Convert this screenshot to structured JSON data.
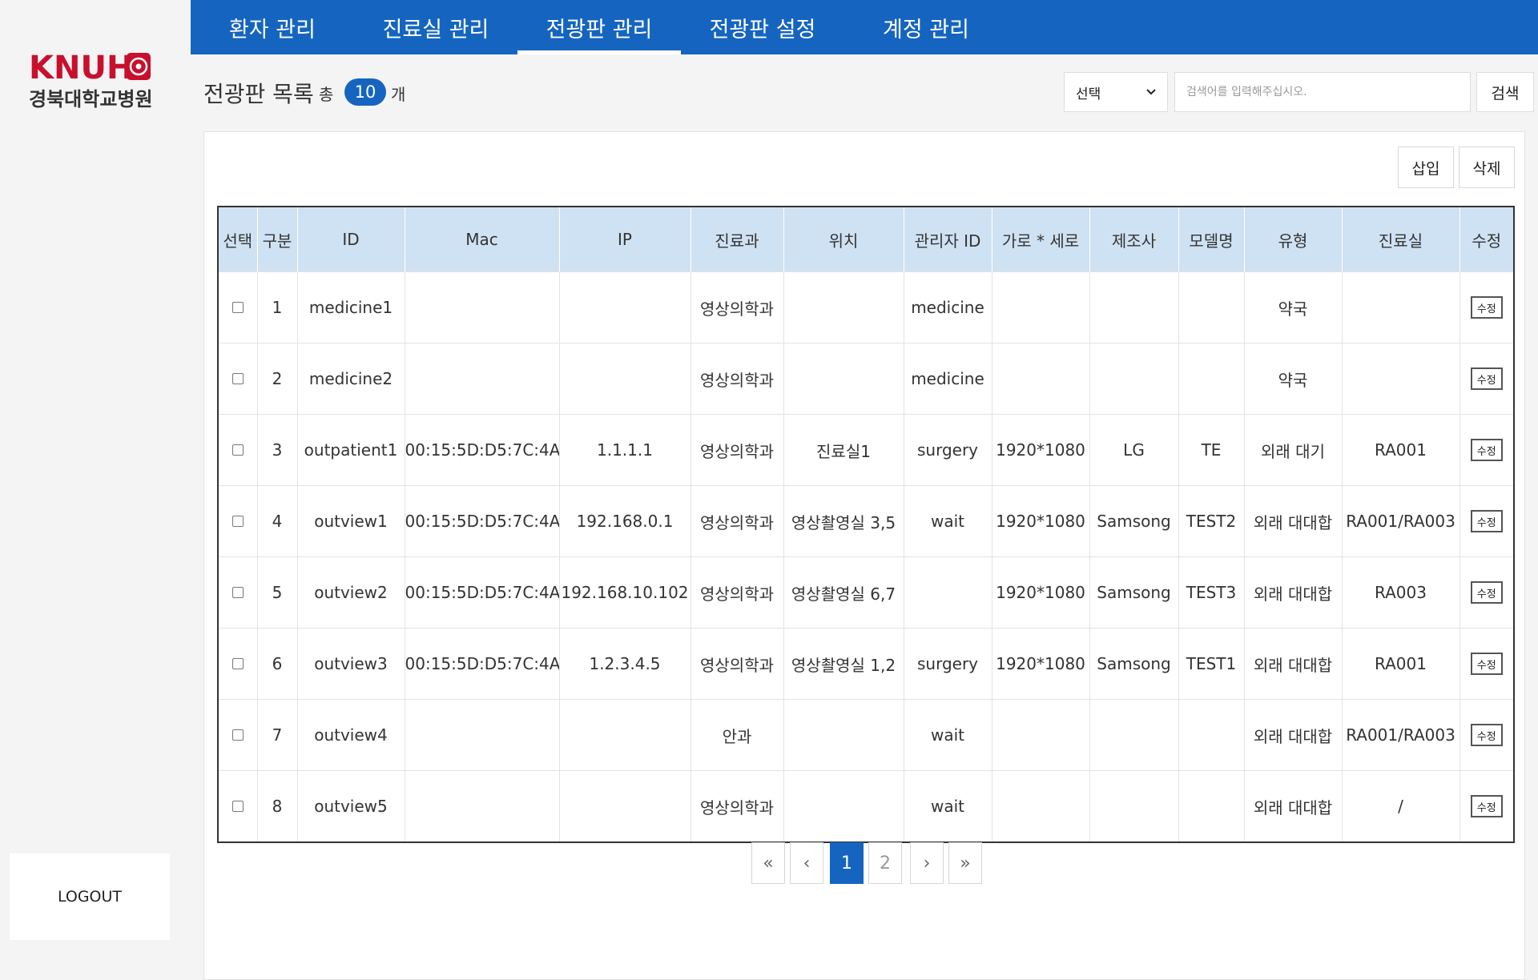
{
  "brand": {
    "logo_text": "KNUH",
    "logo_subtext": "경북대학교병원",
    "color": "#c8102e"
  },
  "nav": {
    "tabs": [
      {
        "label": "환자 관리",
        "active": false
      },
      {
        "label": "진료실 관리",
        "active": false
      },
      {
        "label": "전광판 관리",
        "active": true
      },
      {
        "label": "전광판 설정",
        "active": false
      },
      {
        "label": "계정 관리",
        "active": false
      }
    ],
    "background": "#1565c0"
  },
  "sidebar": {
    "logout_label": "LOGOUT"
  },
  "header": {
    "title": "전광판 목록",
    "total_prefix": "총",
    "total_count": "10",
    "total_suffix": "개"
  },
  "search": {
    "select_value": "선택",
    "placeholder": "검색어를 입력해주십시오.",
    "button_label": "검색"
  },
  "actions": {
    "insert_label": "삽입",
    "delete_label": "삭제"
  },
  "table": {
    "columns": [
      "선택",
      "구분",
      "ID",
      "Mac",
      "IP",
      "진료과",
      "위치",
      "관리자 ID",
      "가로 * 세로",
      "제조사",
      "모델명",
      "유형",
      "진료실",
      "수정"
    ],
    "edit_label": "수정",
    "rows": [
      {
        "no": "1",
        "id": "medicine1",
        "mac": "",
        "ip": "",
        "dept": "영상의학과",
        "location": "",
        "admin_id": "medicine",
        "size": "",
        "maker": "",
        "model": "",
        "type": "약국",
        "room": ""
      },
      {
        "no": "2",
        "id": "medicine2",
        "mac": "",
        "ip": "",
        "dept": "영상의학과",
        "location": "",
        "admin_id": "medicine",
        "size": "",
        "maker": "",
        "model": "",
        "type": "약국",
        "room": ""
      },
      {
        "no": "3",
        "id": "outpatient1",
        "mac": "00:15:5D:D5:7C:4A",
        "ip": "1.1.1.1",
        "dept": "영상의학과",
        "location": "진료실1",
        "admin_id": "surgery",
        "size": "1920*1080",
        "maker": "LG",
        "model": "TE",
        "type": "외래 대기",
        "room": "RA001"
      },
      {
        "no": "4",
        "id": "outview1",
        "mac": "00:15:5D:D5:7C:4A",
        "ip": "192.168.0.1",
        "dept": "영상의학과",
        "location": "영상촬영실 3,5",
        "admin_id": "wait",
        "size": "1920*1080",
        "maker": "Samsong",
        "model": "TEST2",
        "type": "외래 대대합",
        "room": "RA001/RA003"
      },
      {
        "no": "5",
        "id": "outview2",
        "mac": "00:15:5D:D5:7C:4A",
        "ip": "192.168.10.102",
        "dept": "영상의학과",
        "location": "영상촬영실 6,7",
        "admin_id": "",
        "size": "1920*1080",
        "maker": "Samsong",
        "model": "TEST3",
        "type": "외래 대대합",
        "room": "RA003"
      },
      {
        "no": "6",
        "id": "outview3",
        "mac": "00:15:5D:D5:7C:4A",
        "ip": "1.2.3.4.5",
        "dept": "영상의학과",
        "location": "영상촬영실 1,2",
        "admin_id": "surgery",
        "size": "1920*1080",
        "maker": "Samsong",
        "model": "TEST1",
        "type": "외래 대대합",
        "room": "RA001"
      },
      {
        "no": "7",
        "id": "outview4",
        "mac": "",
        "ip": "",
        "dept": "안과",
        "location": "",
        "admin_id": "wait",
        "size": "",
        "maker": "",
        "model": "",
        "type": "외래 대대합",
        "room": "RA001/RA003"
      },
      {
        "no": "8",
        "id": "outview5",
        "mac": "",
        "ip": "",
        "dept": "영상의학과",
        "location": "",
        "admin_id": "wait",
        "size": "",
        "maker": "",
        "model": "",
        "type": "외래 대대합",
        "room": "/"
      }
    ]
  },
  "pagination": {
    "first": "«",
    "prev": "‹",
    "next": "›",
    "last": "»",
    "pages": [
      "1",
      "2"
    ],
    "current": "1"
  }
}
